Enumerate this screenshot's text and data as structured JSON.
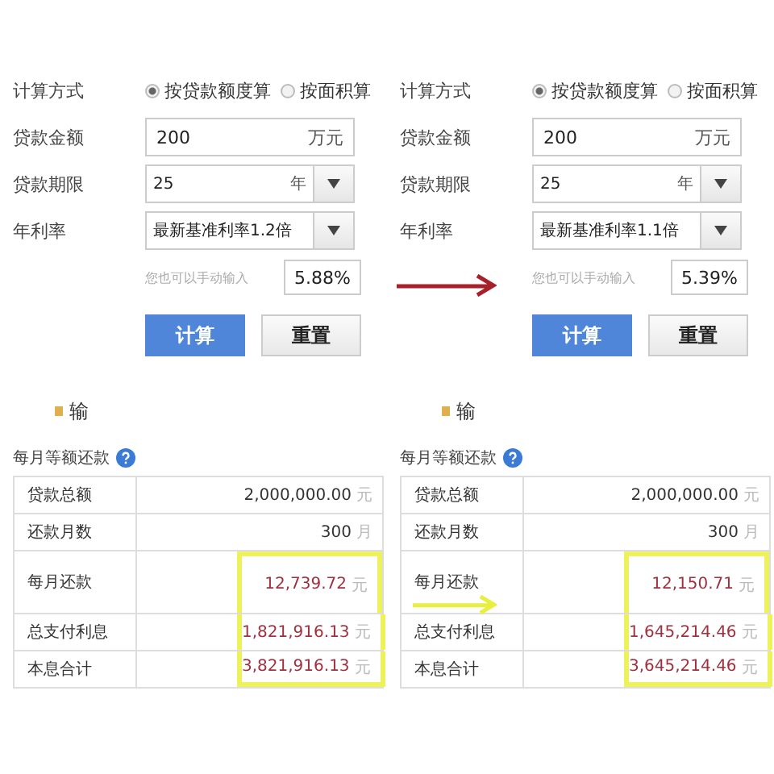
{
  "panels": [
    {
      "method": {
        "label": "计算方式",
        "options": [
          {
            "label": "按贷款额度算",
            "selected": true
          },
          {
            "label": "按面积算",
            "selected": false
          }
        ]
      },
      "amount": {
        "label": "贷款金额",
        "value": "200",
        "unit": "万元"
      },
      "term": {
        "label": "贷款期限",
        "value": "25",
        "unit": "年"
      },
      "rate": {
        "label": "年利率",
        "value": "最新基准利率1.2倍"
      },
      "manual": {
        "hint": "您也可以手动输入",
        "value": "5.88%"
      },
      "buttons": [
        {
          "label": "计算",
          "kind": "primary"
        },
        {
          "label": "重置",
          "kind": "secondary"
        }
      ],
      "section_label": "输",
      "result_title": "每月等额还款",
      "rows": [
        {
          "label": "贷款总额",
          "value": "2,000,000.00",
          "unit": "元",
          "highlighted": false
        },
        {
          "label": "还款月数",
          "value": "300",
          "unit": "月",
          "highlighted": false
        },
        {
          "label": "每月还款",
          "value": "12,739.72",
          "unit": "元",
          "highlighted": true
        },
        {
          "label": "总支付利息",
          "value": "1,821,916.13",
          "unit": "元",
          "highlighted": true
        },
        {
          "label": "本息合计",
          "value": "3,821,916.13",
          "unit": "元",
          "highlighted": true
        }
      ]
    },
    {
      "method": {
        "label": "计算方式",
        "options": [
          {
            "label": "按贷款额度算",
            "selected": true
          },
          {
            "label": "按面积算",
            "selected": false
          }
        ]
      },
      "amount": {
        "label": "贷款金额",
        "value": "200",
        "unit": "万元"
      },
      "term": {
        "label": "贷款期限",
        "value": "25",
        "unit": "年"
      },
      "rate": {
        "label": "年利率",
        "value": "最新基准利率1.1倍"
      },
      "manual": {
        "hint": "您也可以手动输入",
        "value": "5.39%"
      },
      "buttons": [
        {
          "label": "计算",
          "kind": "primary"
        },
        {
          "label": "重置",
          "kind": "secondary"
        }
      ],
      "section_label": "输",
      "result_title": "每月等额还款",
      "rows": [
        {
          "label": "贷款总额",
          "value": "2,000,000.00",
          "unit": "元",
          "highlighted": false
        },
        {
          "label": "还款月数",
          "value": "300",
          "unit": "月",
          "highlighted": false
        },
        {
          "label": "每月还款",
          "value": "12,150.71",
          "unit": "元",
          "highlighted": true
        },
        {
          "label": "总支付利息",
          "value": "1,645,214.46",
          "unit": "元",
          "highlighted": true
        },
        {
          "label": "本息合计",
          "value": "3,645,214.46",
          "unit": "元",
          "highlighted": true
        }
      ]
    }
  ]
}
